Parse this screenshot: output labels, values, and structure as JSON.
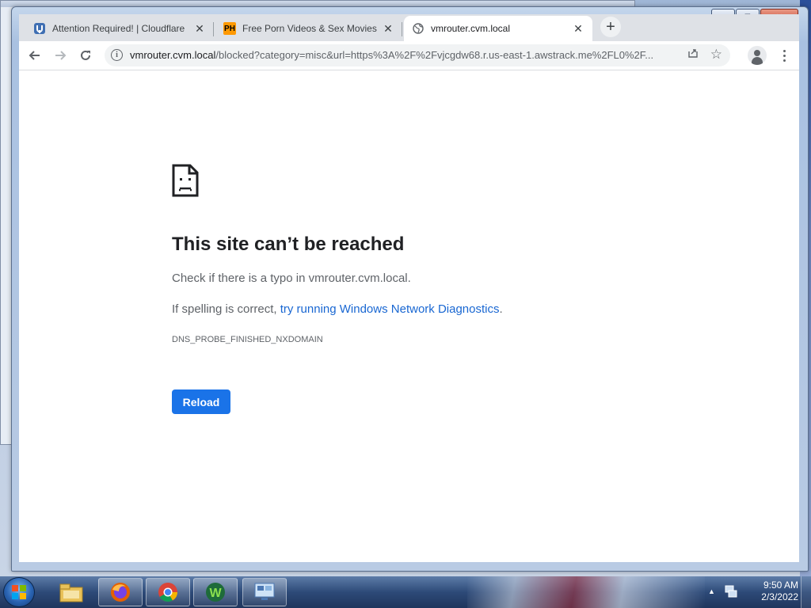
{
  "browser": {
    "tabs": [
      {
        "title": "Attention Required! | Cloudflare",
        "favicon": "cloudflare-favicon",
        "active": false
      },
      {
        "title": "Free Porn Videos & Sex Movies -",
        "favicon": "PH",
        "active": false
      },
      {
        "title": "vmrouter.cvm.local",
        "favicon": "globe-icon",
        "active": true
      }
    ],
    "window_controls": {
      "minimize": "▁",
      "maximize": "□",
      "close": "✕"
    },
    "new_tab": "+",
    "address": {
      "host": "vmrouter.cvm.local",
      "path": "/blocked?category=misc&url=https%3A%2F%2Fvjcgdw68.r.us-east-1.awstrack.me%2FL0%2F..."
    }
  },
  "error_page": {
    "title": "This site can’t be reached",
    "line1": "Check if there is a typo in vmrouter.cvm.local.",
    "line2_prefix": "If spelling is correct, ",
    "line2_link": "try running Windows Network Diagnostics",
    "line2_suffix": ".",
    "code": "DNS_PROBE_FINISHED_NXDOMAIN",
    "reload_label": "Reload"
  },
  "taskbar": {
    "items": [
      "windows-explorer",
      "firefox",
      "chrome",
      "wireshark",
      "remote-desktop"
    ],
    "clock_time": "9:50 AM",
    "clock_date": "2/3/2022"
  },
  "colors": {
    "link": "#1967d2",
    "button": "#1a73e8",
    "title": "#202124",
    "body_text": "#5f6368"
  }
}
